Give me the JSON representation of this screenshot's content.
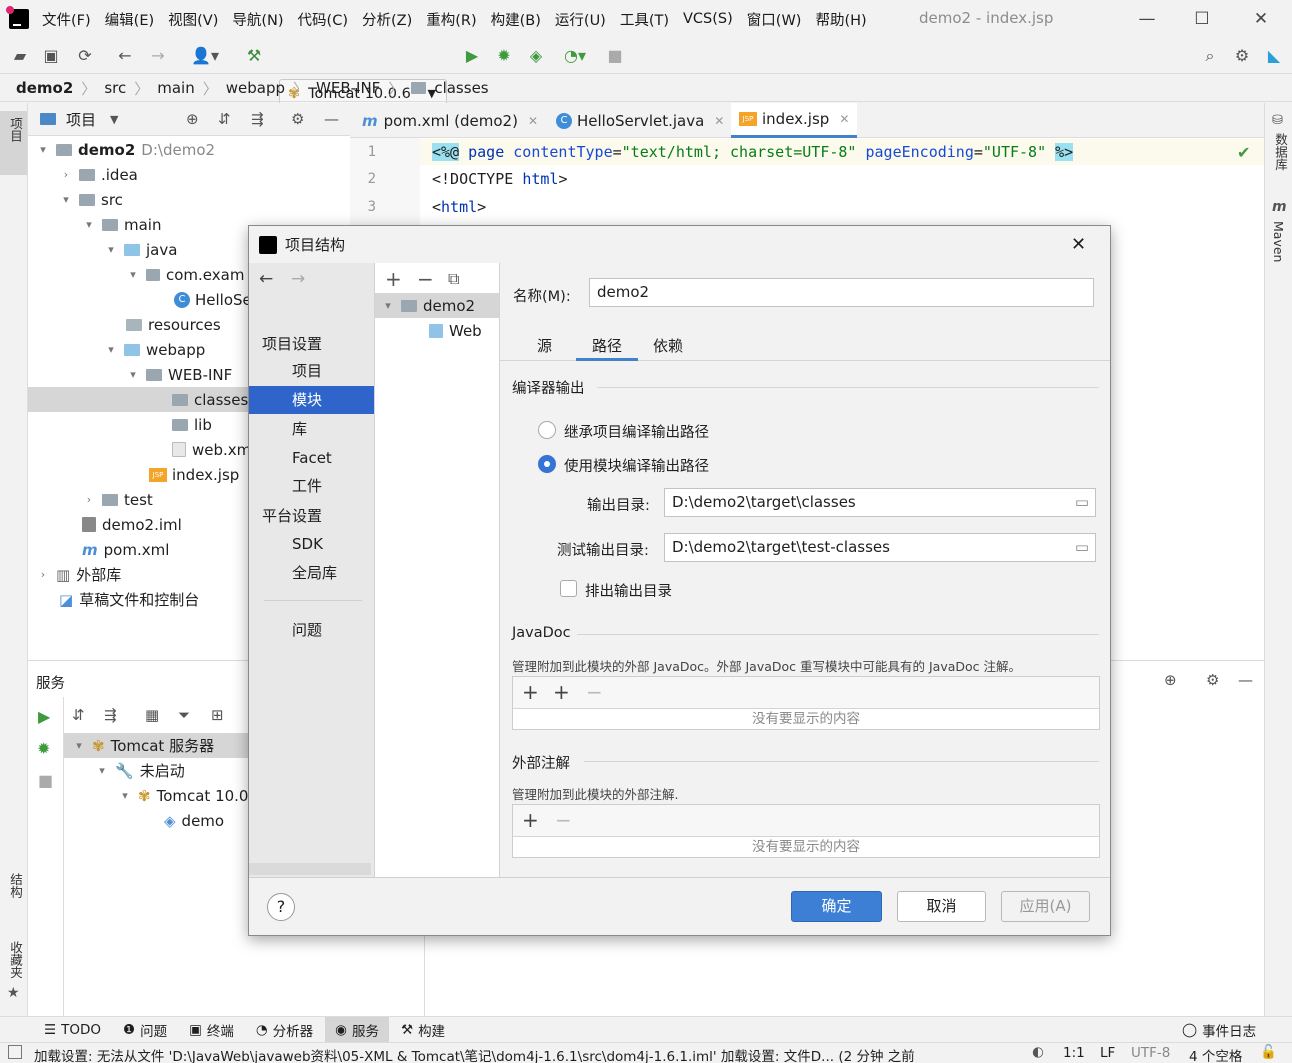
{
  "menubar": {
    "items": [
      "文件(F)",
      "编辑(E)",
      "视图(V)",
      "导航(N)",
      "代码(C)",
      "分析(Z)",
      "重构(R)",
      "构建(B)",
      "运行(U)",
      "工具(T)",
      "VCS(S)",
      "窗口(W)",
      "帮助(H)"
    ],
    "title": "demo2 - index.jsp"
  },
  "toolbar": {
    "run_config": "Tomcat 10.0.6"
  },
  "breadcrumb": [
    "demo2",
    "src",
    "main",
    "webapp",
    "WEB-INF",
    "classes"
  ],
  "left_stripe": {
    "project": "项目",
    "structure": "结构",
    "favorites": "收藏夹"
  },
  "right_stripe": {
    "database": "数据库",
    "maven": "Maven"
  },
  "project": {
    "header": "项目",
    "root_name": "demo2",
    "root_path": "D:\\demo2",
    "items": [
      ".idea",
      "src",
      "main",
      "java",
      "com.exam",
      "HelloSe",
      "resources",
      "webapp",
      "WEB-INF",
      "classes",
      "lib",
      "web.xm",
      "index.jsp",
      "test",
      "demo2.iml",
      "pom.xml",
      "外部库",
      "草稿文件和控制台"
    ]
  },
  "editor": {
    "tabs": [
      "pom.xml (demo2)",
      "HelloServlet.java",
      "index.jsp"
    ],
    "line_numbers": [
      "1",
      "2",
      "3"
    ],
    "lines": {
      "l1_open": "<%@",
      "l1_page": "page",
      "l1_a1": "contentType",
      "l1_v1": "\"text/html; charset=UTF-8\"",
      "l1_a2": "pageEncoding",
      "l1_v2": "\"UTF-8\"",
      "l1_close": "%>",
      "l2_a": "<!DOCTYPE ",
      "l2_b": "html",
      "l2_c": ">",
      "l3_a": "<",
      "l3_b": "html",
      "l3_c": ">"
    }
  },
  "services": {
    "title": "服务",
    "tree": [
      "Tomcat 服务器",
      "未启动",
      "Tomcat 10.0",
      "demo"
    ]
  },
  "dialog": {
    "title": "项目结构",
    "nav": {
      "project_settings": "项目设置",
      "items1": [
        "项目",
        "模块",
        "库",
        "Facet",
        "工件"
      ],
      "platform_settings": "平台设置",
      "items2": [
        "SDK",
        "全局库"
      ],
      "problems": "问题"
    },
    "modules": {
      "module": "demo2",
      "facet": "Web"
    },
    "name_label": "名称(M):",
    "name_value": "demo2",
    "tabs": [
      "源",
      "路径",
      "依赖"
    ],
    "compiler_output": "编译器输出",
    "radio_inherit": "继承项目编译输出路径",
    "radio_module": "使用模块编译输出路径",
    "output_label": "输出目录:",
    "output_value": "D:\\demo2\\target\\classes",
    "test_output_label": "测试输出目录:",
    "test_output_value": "D:\\demo2\\target\\test-classes",
    "exclude_label": "排出输出目录",
    "javadoc_title": "JavaDoc",
    "javadoc_desc": "管理附加到此模块的外部 JavaDoc。外部 JavaDoc 重写模块中可能具有的 JavaDoc 注解。",
    "empty": "没有要显示的内容",
    "ext_title": "外部注解",
    "ext_desc": "管理附加到此模块的外部注解.",
    "ok": "确定",
    "cancel": "取消",
    "apply": "应用(A)",
    "help": "?"
  },
  "toolwindows": [
    "TODO",
    "问题",
    "终端",
    "分析器",
    "服务",
    "构建"
  ],
  "event_log": "事件日志",
  "status": {
    "message": "加载设置: 无法从文件 'D:\\JavaWeb\\javaweb资料\\05-XML & Tomcat\\笔记\\dom4j-1.6.1\\src\\dom4j-1.6.1.iml' 加载设置: 文件D... (2 分钟 之前",
    "pos": "1:1",
    "lf": "LF",
    "enc": "UTF-8",
    "indent": "4 个空格"
  },
  "colors": {
    "accent": "#2f65ca",
    "primary_button": "#3c7fd5",
    "keyword": "#0033b3",
    "string": "#067d17",
    "jsp_tag_bg": "#99e0f0"
  }
}
